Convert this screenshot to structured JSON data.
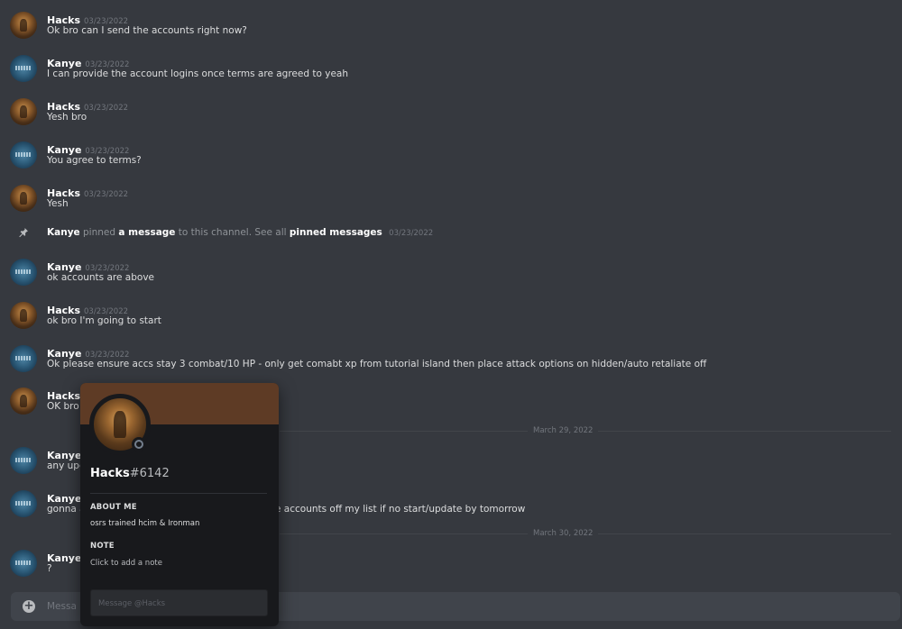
{
  "messages": [
    {
      "author": "Hacks",
      "avatar": "hacks-avatar",
      "timestamp": "03/23/2022",
      "text": "Ok bro can I send the accounts right now?"
    },
    {
      "author": "Kanye",
      "avatar": "kanye-avatar",
      "timestamp": "03/23/2022",
      "text": "I can provide the account logins once terms are agreed to yeah"
    },
    {
      "author": "Hacks",
      "avatar": "hacks-avatar",
      "timestamp": "03/23/2022",
      "text": "Yesh bro"
    },
    {
      "author": "Kanye",
      "avatar": "kanye-avatar",
      "timestamp": "03/23/2022",
      "text": "You agree to terms?"
    },
    {
      "author": "Hacks",
      "avatar": "hacks-avatar",
      "timestamp": "03/23/2022",
      "text": "Yesh"
    },
    {
      "author": "Kanye",
      "avatar": "kanye-avatar",
      "timestamp": "03/23/2022",
      "text": "ok accounts are above"
    },
    {
      "author": "Hacks",
      "avatar": "hacks-avatar",
      "timestamp": "03/23/2022",
      "text": "ok bro I'm going to start"
    },
    {
      "author": "Kanye",
      "avatar": "kanye-avatar",
      "timestamp": "03/23/2022",
      "text": "Ok please ensure accs stay 3 combat/10 HP - only get comabt xp from tutorial island then place attack options on hidden/auto retaliate off"
    },
    {
      "author": "Hacks",
      "avatar": "hacks-avatar",
      "timestamp": "",
      "text": "OK bro"
    },
    {
      "author": "Kanye",
      "avatar": "kanye-avatar",
      "timestamp": "",
      "text": "any upd"
    },
    {
      "author": "Kanye",
      "avatar": "kanye-avatar",
      "timestamp": "",
      "text": "gonna a"
    },
    {
      "author": "Kanye",
      "avatar": "kanye-avatar",
      "timestamp": "",
      "text": "?"
    }
  ],
  "message_tail_visible": "e accounts off my list if no start/update by tomorrow",
  "pin_notice": {
    "author": "Kanye",
    "pinned": "pinned",
    "link_message": "a message",
    "middle": "to this channel. See all",
    "link_pinned": "pinned messages",
    "timestamp": "03/23/2022"
  },
  "dividers": [
    "March 29, 2022",
    "March 30, 2022"
  ],
  "composer": {
    "placeholder": "Messa"
  },
  "profile_popout": {
    "username": "Hacks",
    "discriminator": "#6142",
    "about_me_label": "ABOUT ME",
    "about_me": "osrs trained hcim & Ironman",
    "note_label": "NOTE",
    "note_placeholder": "Click to add a note",
    "message_placeholder": "Message @Hacks",
    "banner_color": "#5e3b25",
    "status": "offline"
  },
  "colors": {
    "background": "#36393f",
    "popout_background": "#18191c",
    "timestamp": "#72767d",
    "text": "#dcddde"
  }
}
